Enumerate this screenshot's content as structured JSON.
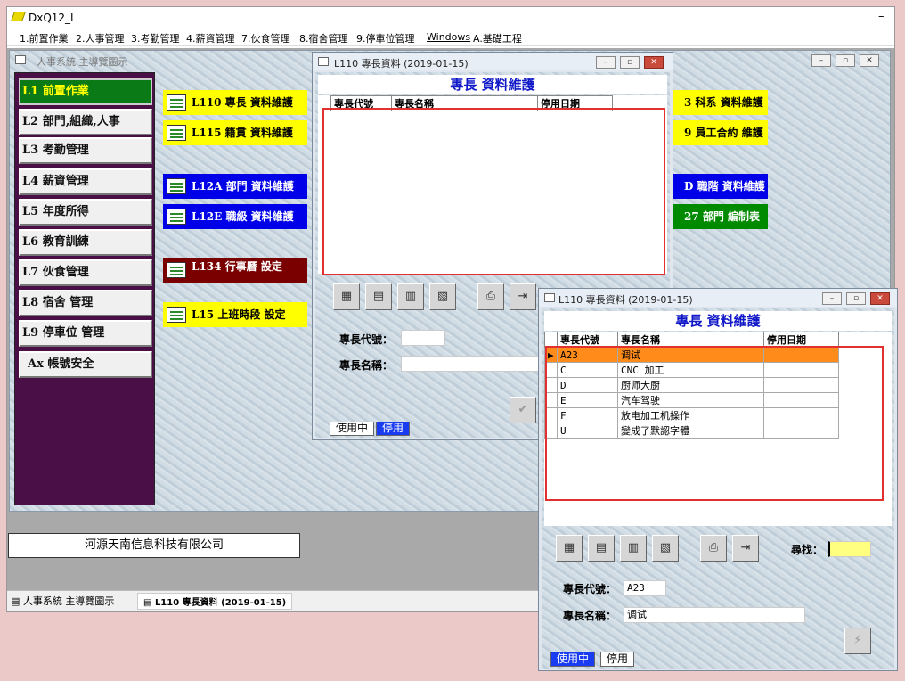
{
  "app": {
    "title": "DxQ12_L",
    "minimize": "–"
  },
  "menu": [
    "1.前置作業",
    "2.人事管理",
    "3.考勤管理",
    "4.薪資管理",
    "7.伙食管理",
    "8.宿舍管理",
    "9.停車位管理",
    "Windows",
    "A.基礎工程"
  ],
  "nav_window": {
    "title": "人事系統 主導覽圖示"
  },
  "nav": [
    "L1 前置作業",
    "L2 部門,組織,人事",
    "L3 考勤管理",
    "L4 薪資管理",
    "L5 年度所得",
    "L6 教育訓練",
    "L7 伙食管理",
    "L8 宿舍 管理",
    "L9 停車位 管理",
    "Ax 帳號安全"
  ],
  "modules": {
    "m1": "L110 專長 資料維護",
    "m2": "L115 籍貫 資料維護",
    "m3": "L12A 部門 資料維護",
    "m4": "L12E 職級 資料維護",
    "m5": "L134 行事曆 設定",
    "m6": "L15 上班時段 設定",
    "r1": "3 科系 資料維護",
    "r2": "9 員工合約 維護",
    "r3": "D 職階 資料維護",
    "r4": "27 部門 編制表"
  },
  "company": "河源天南信息科技有限公司",
  "taskbar": [
    "人事系統 主導覽圖示",
    "L110 專長資料 (2019-01-15)"
  ],
  "win1": {
    "title": "L110 專長資料 (2019-01-15)",
    "heading": "專長 資料維護",
    "columns": [
      "專長代號",
      "專長名稱",
      "停用日期"
    ],
    "code_label": "專長代號：",
    "name_label": "專長名稱：",
    "tabs": [
      "使用中",
      "停用"
    ]
  },
  "win2": {
    "title": "L110 專長資料 (2019-01-15)",
    "heading": "專長 資料維護",
    "columns": [
      "專長代號",
      "專長名稱",
      "停用日期"
    ],
    "rows": [
      [
        "A23",
        "调试",
        ""
      ],
      [
        "C",
        "CNC 加工",
        ""
      ],
      [
        "D",
        "厨师大厨",
        ""
      ],
      [
        "E",
        "汽车驾驶",
        ""
      ],
      [
        "F",
        "放电加工机操作",
        ""
      ],
      [
        "U",
        "變成了默認字體",
        ""
      ]
    ],
    "search_label": "尋找：",
    "code_label": "專長代號：",
    "code_value": "A23",
    "name_label": "專長名稱：",
    "name_value": "调试",
    "tabs": [
      "使用中",
      "停用"
    ]
  }
}
